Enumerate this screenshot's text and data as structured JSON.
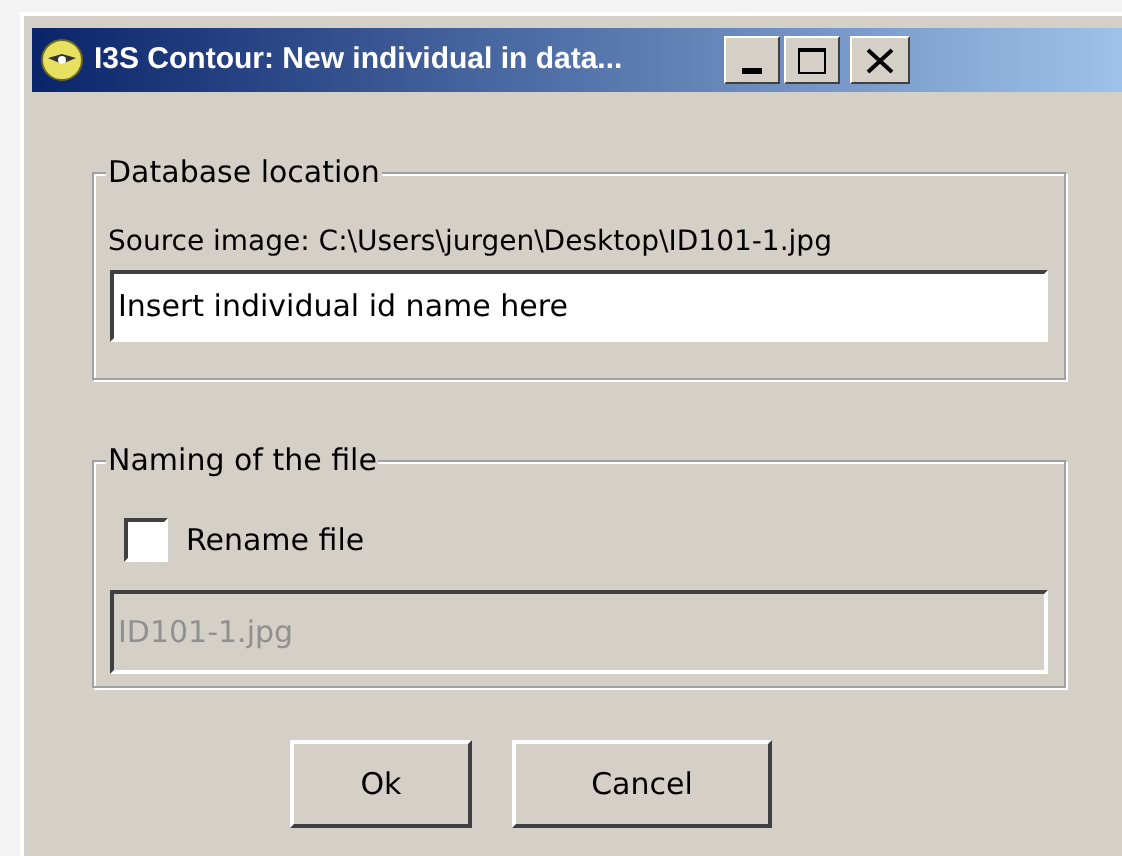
{
  "window": {
    "title": "I3S Contour: New individual in data..."
  },
  "database_location": {
    "legend": "Database location",
    "source_label": "Source image: C:\\Users\\jurgen\\Desktop\\ID101-1.jpg",
    "id_field": {
      "value": "Insert individual id name here"
    }
  },
  "naming": {
    "legend": "Naming of the file",
    "rename": {
      "label": "Rename file",
      "checked": false
    },
    "file_field": {
      "value": "ID101-1.jpg",
      "disabled": true
    }
  },
  "buttons": [
    "Ok",
    "Cancel"
  ]
}
